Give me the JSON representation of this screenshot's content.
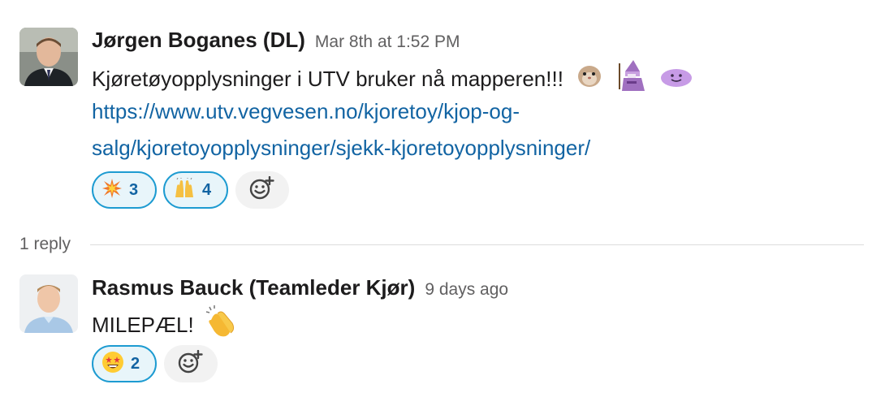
{
  "messages": [
    {
      "author": "Jørgen Boganes (DL)",
      "timestamp": "Mar 8th at 1:52 PM",
      "text": "Kjøretøyopplysninger i UTV bruker nå mapperen!!!",
      "link_line1": "https://www.utv.vegvesen.no/kjoretoy/kjop-og-",
      "link_line2": "salg/kjoretoyopplysninger/sjekk-kjoretoyopplysninger/",
      "inline_emojis": [
        "hamster-icon",
        "wizard-icon",
        "purple-blob-icon"
      ],
      "reactions": [
        {
          "icon": "collision-icon",
          "count": "3"
        },
        {
          "icon": "raised-hands-icon",
          "count": "4"
        }
      ]
    },
    {
      "author": "Rasmus Bauck (Teamleder Kjør)",
      "timestamp": "9 days ago",
      "text": "MILEPÆL!",
      "inline_emojis": [
        "clapping-hands-icon"
      ],
      "reactions": [
        {
          "icon": "star-struck-icon",
          "count": "2"
        }
      ]
    }
  ],
  "thread": {
    "reply_count": "1 reply"
  },
  "colors": {
    "link": "#1264a3",
    "reaction_border": "#1d9bd1",
    "reaction_bg": "#e8f5fa",
    "muted": "#616061"
  }
}
